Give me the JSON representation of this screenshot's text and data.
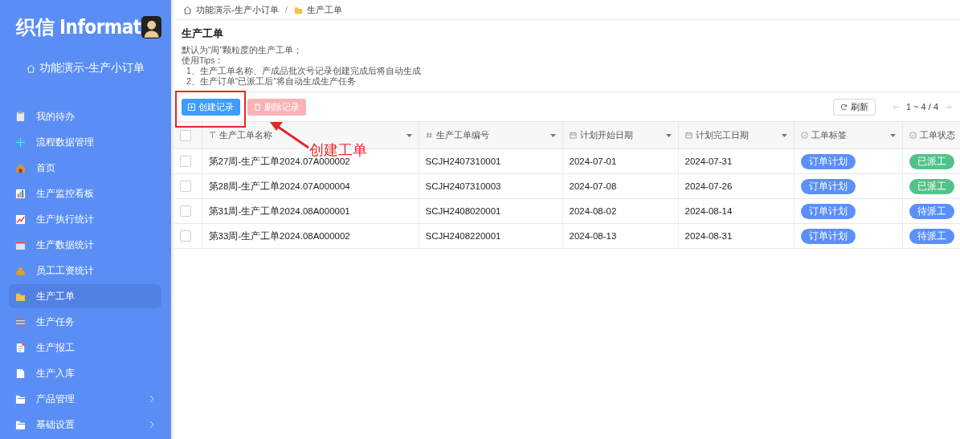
{
  "sidebar": {
    "logo": "织信 Informat",
    "app_name": "功能演示-生产小订单",
    "items": [
      {
        "label": "我的待办",
        "kind": "link",
        "selected": false
      },
      {
        "label": "流程数据管理",
        "kind": "link",
        "selected": false
      },
      {
        "label": "首页",
        "kind": "link",
        "selected": false
      },
      {
        "label": "生产监控看板",
        "kind": "link",
        "selected": false
      },
      {
        "label": "生产执行统计",
        "kind": "link",
        "selected": false
      },
      {
        "label": "生产数据统计",
        "kind": "link",
        "selected": false
      },
      {
        "label": "员工工资统计",
        "kind": "link",
        "selected": false
      },
      {
        "label": "生产工单",
        "kind": "link",
        "selected": true
      },
      {
        "label": "生产任务",
        "kind": "link",
        "selected": false
      },
      {
        "label": "生产报工",
        "kind": "link",
        "selected": false
      },
      {
        "label": "生产入库",
        "kind": "link",
        "selected": false
      },
      {
        "label": "产品管理",
        "kind": "group",
        "selected": false
      },
      {
        "label": "基础设置",
        "kind": "group",
        "selected": false
      }
    ]
  },
  "breadcrumb": [
    "功能演示-生产小订单",
    "/",
    "生产工单"
  ],
  "page": {
    "title": "生产工单",
    "description": [
      {
        "text": "默认为“周”颗粒度的生产工单；",
        "kind": "line"
      },
      {
        "text": "使用Tips：",
        "kind": "line"
      },
      {
        "text": "1、生产工单名称、产成品批次号记录创建完成后将自动生成",
        "kind": "item"
      },
      {
        "text": "2、生产订单“已派工后”将自动生成生产任务",
        "kind": "item"
      }
    ]
  },
  "toolbar": {
    "create_button": {
      "label": "创建记录",
      "disabled": false
    },
    "delete_button": {
      "label": "删除记录",
      "disabled": true
    },
    "refresh_button": "刷新",
    "pagination": "1 ~ 4 / 4"
  },
  "table": {
    "select_all": {
      "checked": false
    },
    "columns": [
      {
        "label": "生产工单名称",
        "kind": "text"
      },
      {
        "label": "生产工单编号",
        "kind": "number"
      },
      {
        "label": "计划开始日期",
        "kind": "date"
      },
      {
        "label": "计划完工日期",
        "kind": "date"
      },
      {
        "label": "工单标签",
        "kind": "tag"
      },
      {
        "label": "工单状态",
        "kind": "tag"
      }
    ],
    "rows": [
      {
        "checked": false,
        "name": "第27周-生产工单2024.07A000002",
        "code": "SCJH2407310001",
        "start": "2024-07-01",
        "end": "2024-07-31",
        "tag": {
          "text": "订单计划",
          "color": "#5b8ff9"
        },
        "status": {
          "text": "已派工",
          "color": "#52c28a"
        }
      },
      {
        "checked": false,
        "name": "第28周-生产工单2024.07A000004",
        "code": "SCJH2407310003",
        "start": "2024-07-08",
        "end": "2024-07-26",
        "tag": {
          "text": "订单计划",
          "color": "#5b8ff9"
        },
        "status": {
          "text": "已派工",
          "color": "#52c28a"
        }
      },
      {
        "checked": false,
        "name": "第31周-生产工单2024.08A000001",
        "code": "SCJH2408020001",
        "start": "2024-08-02",
        "end": "2024-08-14",
        "tag": {
          "text": "订单计划",
          "color": "#5b8ff9"
        },
        "status": {
          "text": "待派工",
          "color": "#5b8ff9"
        }
      },
      {
        "checked": false,
        "name": "第33周-生产工单2024.08A000002",
        "code": "SCJH2408220001",
        "start": "2024-08-13",
        "end": "2024-08-31",
        "tag": {
          "text": "订单计划",
          "color": "#5b8ff9"
        },
        "status": {
          "text": "待派工",
          "color": "#5b8ff9"
        }
      }
    ]
  },
  "annotation": {
    "label": "创建工单"
  }
}
